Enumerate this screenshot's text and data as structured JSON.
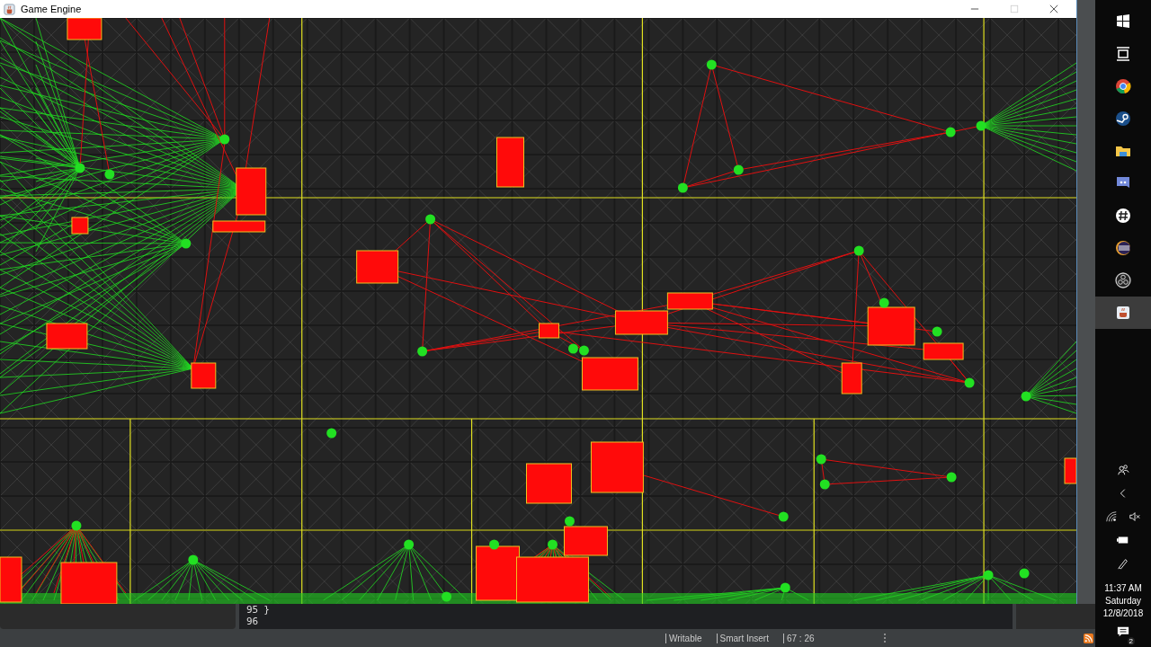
{
  "window": {
    "title": "Game Engine"
  },
  "editor": {
    "lines": [
      {
        "number": "95",
        "code": "}"
      },
      {
        "number": "96"
      }
    ]
  },
  "status_bar": {
    "items": [
      "Writable",
      "Smart Insert",
      "67 : 26"
    ]
  },
  "taskbar": {
    "time": "11:37 AM",
    "day": "Saturday",
    "date": "12/8/2018",
    "notifications": "2"
  }
}
